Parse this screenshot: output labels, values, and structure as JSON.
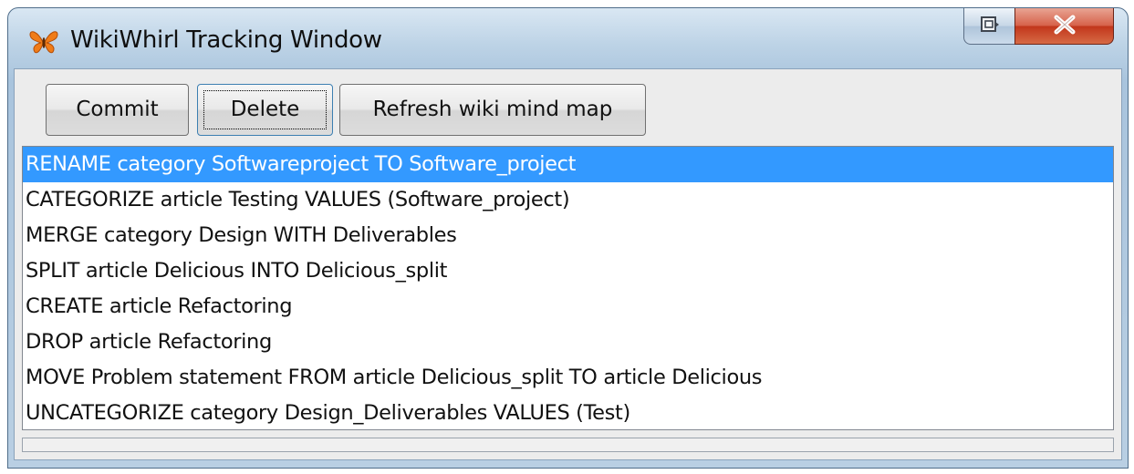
{
  "window": {
    "title": "WikiWhirl Tracking Window",
    "app_icon": "butterfly-icon",
    "controls": {
      "restore_icon": "restore-icon",
      "close_icon": "close-icon"
    }
  },
  "toolbar": {
    "commit_label": "Commit",
    "delete_label": "Delete",
    "refresh_label": "Refresh wiki mind map",
    "focused": "Delete"
  },
  "operations": {
    "selected_index": 0,
    "items": [
      "RENAME category Softwareproject TO Software_project",
      "CATEGORIZE article Testing VALUES (Software_project)",
      "MERGE category Design WITH Deliverables",
      "SPLIT article Delicious INTO Delicious_split",
      "CREATE article Refactoring",
      "DROP article Refactoring",
      "MOVE Problem statement FROM article Delicious_split TO article Delicious",
      "UNCATEGORIZE category Design_Deliverables VALUES (Test)"
    ]
  },
  "colors": {
    "selection": "#3399ff",
    "titlebar": "#bdd3e6",
    "close_button": "#c2371c"
  }
}
